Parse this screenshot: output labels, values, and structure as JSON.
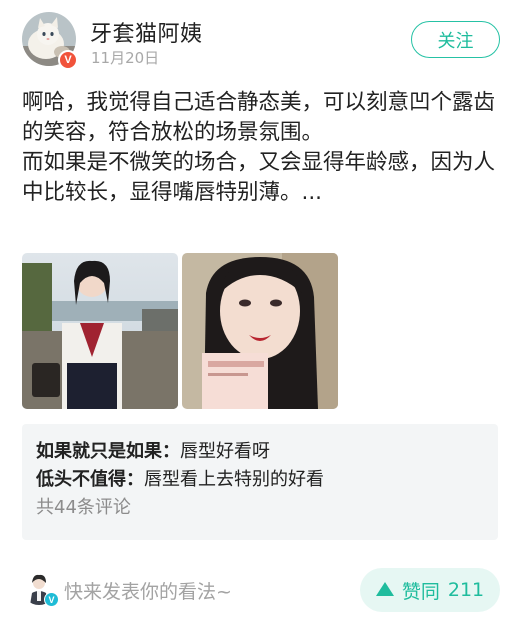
{
  "header": {
    "username": "牙套猫阿姨",
    "date": "11月20日",
    "verified_badge": "V",
    "follow_label": "关注"
  },
  "post": {
    "paragraphs": [
      "啊哈，我觉得自己适合静态美，可以刻意凹个露齿的笑容，符合放松的场景氛围。",
      "而如果是不微笑的场合，又会显得年龄感，因为人中比较长，显得嘴唇特别薄。..."
    ]
  },
  "comments": {
    "items": [
      {
        "user": "如果就只是如果：",
        "text": "唇型好看呀"
      },
      {
        "user": "低头不值得：",
        "text": "唇型看上去特别的好看"
      }
    ],
    "total_label": "共44条评论"
  },
  "footer": {
    "input_placeholder": "快来发表你的看法~",
    "my_badge": "V",
    "like_label": "赞同",
    "like_count": "211"
  },
  "colors": {
    "accent": "#1fbc9d",
    "badge_red": "#f1533b",
    "badge_blue": "#1fbcd6"
  }
}
